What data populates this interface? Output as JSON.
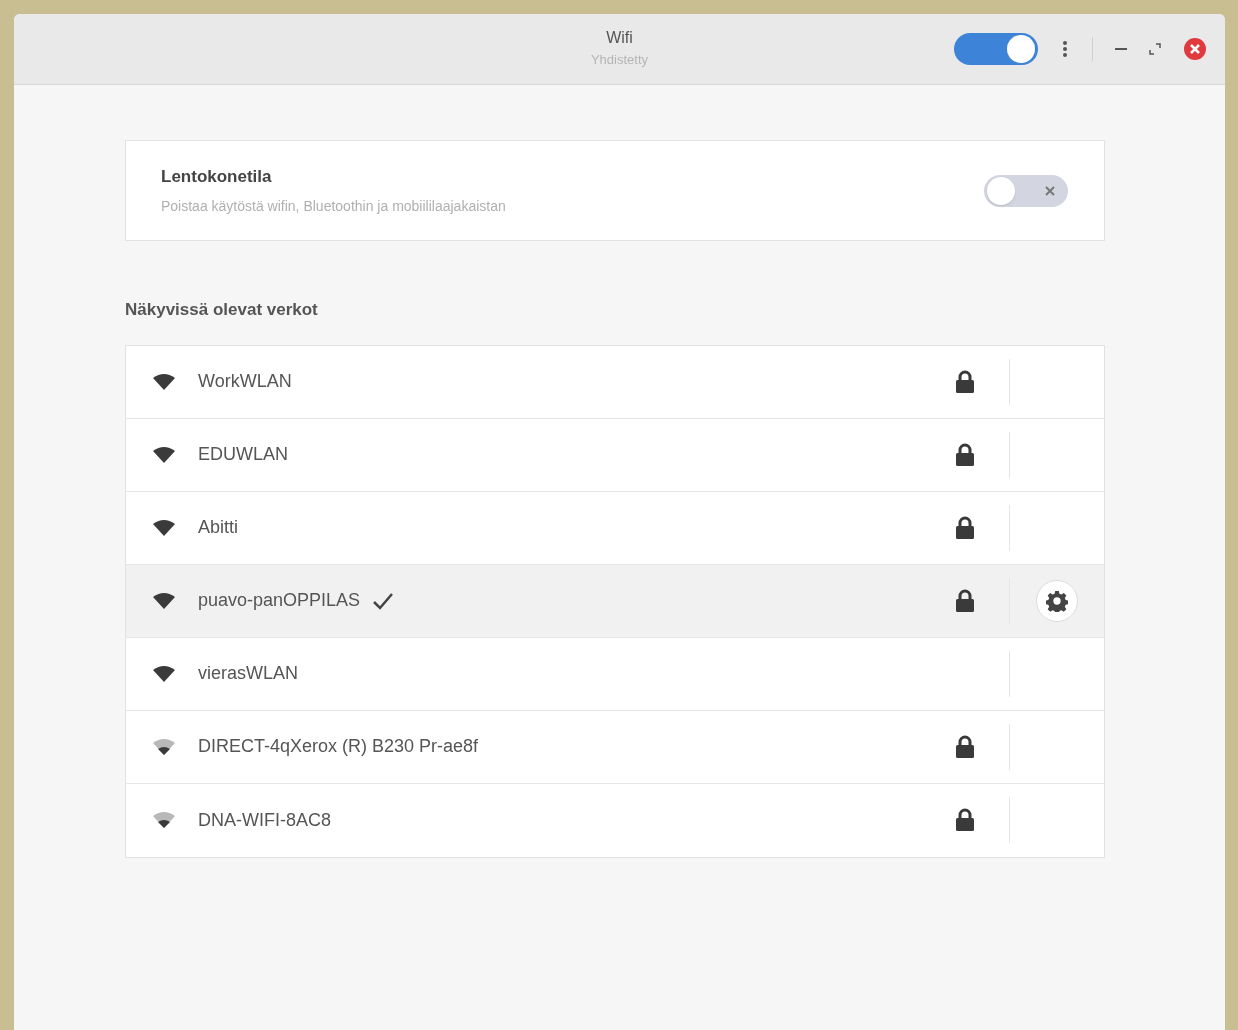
{
  "window": {
    "title": "Wifi",
    "subtitle": "Yhdistetty",
    "wifi_switch": {
      "on": true
    }
  },
  "airplane_mode": {
    "title": "Lentokonetila",
    "description": "Poistaa käytöstä wifin, Bluetoothin ja mobiililaajakaistan",
    "on": false
  },
  "networks_heading": "Näkyvissä olevat verkot",
  "networks": [
    {
      "name": "WorkWLAN",
      "kind": "strong",
      "secured": true,
      "connected": false
    },
    {
      "name": "EDUWLAN",
      "kind": "strong",
      "secured": true,
      "connected": false
    },
    {
      "name": "Abitti",
      "kind": "strong",
      "secured": true,
      "connected": false
    },
    {
      "name": "puavo-panOPPILAS",
      "kind": "strong",
      "secured": true,
      "connected": true
    },
    {
      "name": "vierasWLAN",
      "kind": "strong",
      "secured": false,
      "connected": false
    },
    {
      "name": "DIRECT-4qXerox (R) B230 Pr-ae8f",
      "kind": "weak",
      "secured": true,
      "connected": false
    },
    {
      "name": "DNA-WIFI-8AC8",
      "kind": "weak",
      "secured": true,
      "connected": false
    }
  ]
}
